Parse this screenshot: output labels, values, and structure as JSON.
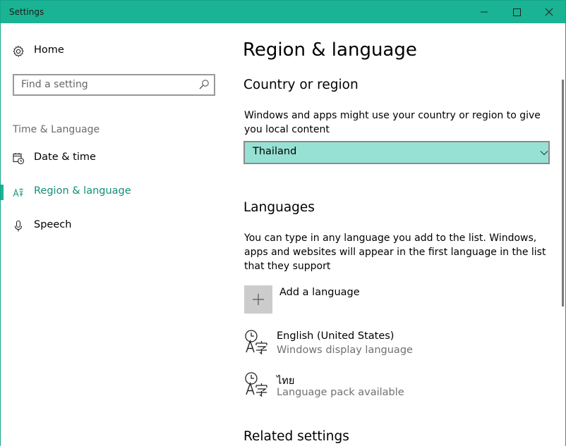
{
  "window": {
    "title": "Settings"
  },
  "sidebar": {
    "home_label": "Home",
    "search_placeholder": "Find a setting",
    "group_heading": "Time & Language",
    "items": [
      {
        "label": "Date & time",
        "icon": "calendar-clock-icon",
        "active": false
      },
      {
        "label": "Region & language",
        "icon": "language-icon",
        "active": true
      },
      {
        "label": "Speech",
        "icon": "microphone-icon",
        "active": false
      }
    ]
  },
  "main": {
    "page_title": "Region & language",
    "country": {
      "heading": "Country or region",
      "description": "Windows and apps might use your country or region to give you local content",
      "selected": "Thailand"
    },
    "languages": {
      "heading": "Languages",
      "description": "You can type in any language you add to the list. Windows, apps and websites will appear in the first language in the list that they support",
      "add_label": "Add a language",
      "list": [
        {
          "name": "English (United States)",
          "status": "Windows display language"
        },
        {
          "name": "ไทย",
          "status": "Language pack available"
        }
      ]
    },
    "related_heading": "Related settings"
  },
  "colors": {
    "accent": "#1ab394",
    "dropdown_bg": "#96e1d3",
    "active_text": "#0e8f76"
  }
}
